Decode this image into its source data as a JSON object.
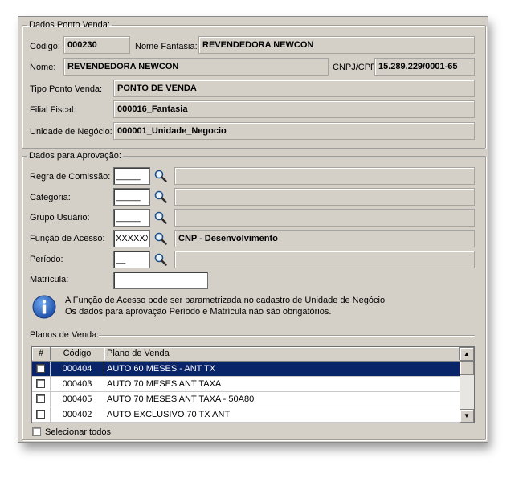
{
  "dados_ponto_venda": {
    "legend": "Dados Ponto Venda:",
    "codigo_label": "Código:",
    "codigo_value": "000230",
    "nome_fantasia_label": "Nome Fantasia:",
    "nome_fantasia_value": "REVENDEDORA NEWCON",
    "nome_label": "Nome:",
    "nome_value": "REVENDEDORA NEWCON",
    "cnpj_label": "CNPJ/CPF:",
    "cnpj_value": "15.289.229/0001-65",
    "tipo_label": "Tipo Ponto Venda:",
    "tipo_value": "PONTO DE VENDA",
    "filial_label": "Filial Fiscal:",
    "filial_value": "000016_Fantasia",
    "unidade_label": "Unidade de Negócio:",
    "unidade_value": "000001_Unidade_Negocio"
  },
  "dados_aprovacao": {
    "legend": "Dados para Aprovação:",
    "regra_label": "Regra de Comissão:",
    "regra_value": "_____",
    "regra_desc": "",
    "categoria_label": "Categoria:",
    "categoria_value": "_____",
    "categoria_desc": "",
    "grupo_label": "Grupo Usuário:",
    "grupo_value": "_____",
    "grupo_desc": "",
    "funcao_label": "Função de Acesso:",
    "funcao_value": "XXXXXX",
    "funcao_desc": "CNP - Desenvolvimento",
    "periodo_label": "Período:",
    "periodo_value": "__",
    "periodo_desc": "",
    "matricula_label": "Matrícula:",
    "matricula_value": "",
    "info_line1": "A Função de Acesso pode ser parametrizada no cadastro de Unidade de Negócio",
    "info_line2": "Os dados para aprovação Período e Matrícula não são obrigatórios."
  },
  "planos": {
    "legend": "Planos de Venda:",
    "columns": [
      "#",
      "Código",
      "Plano de Venda"
    ],
    "rows": [
      {
        "codigo": "000404",
        "plano": "AUTO 60 MESES - ANT TX",
        "selected": true
      },
      {
        "codigo": "000403",
        "plano": "AUTO 70 MESES ANT TAXA",
        "selected": false
      },
      {
        "codigo": "000405",
        "plano": "AUTO 70 MESES ANT TAXA - 50A80",
        "selected": false
      },
      {
        "codigo": "000402",
        "plano": "AUTO EXCLUSIVO 70 TX ANT",
        "selected": false
      }
    ],
    "select_all_label": "Selecionar todos"
  },
  "colors": {
    "window_bg": "#d4d0c8",
    "selection_bg": "#0a246a",
    "info_blue": "#1f4fa8"
  }
}
